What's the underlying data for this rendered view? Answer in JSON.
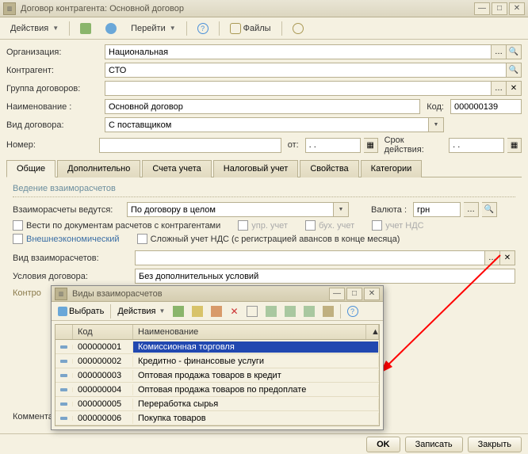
{
  "window": {
    "title": "Договор контрагента: Основной договор"
  },
  "toolbar": {
    "actions": "Действия",
    "goto": "Перейти",
    "files": "Файлы"
  },
  "form": {
    "org_lbl": "Организация:",
    "org_val": "Национальная",
    "contragent_lbl": "Контрагент:",
    "contragent_val": "СТО",
    "group_lbl": "Группа договоров:",
    "group_val": "",
    "name_lbl": "Наименование :",
    "name_val": "Основной договор",
    "code_lbl": "Код:",
    "code_val": "000000139",
    "type_lbl": "Вид договора:",
    "type_val": "С поставщиком",
    "number_lbl": "Номер:",
    "number_val": "",
    "from_lbl": "от:",
    "from_val": ". .",
    "valid_lbl": "Срок действия:",
    "valid_val": ". ."
  },
  "tabs": {
    "t0": "Общие",
    "t1": "Дополнительно",
    "t2": "Счета учета",
    "t3": "Налоговый учет",
    "t4": "Свойства",
    "t5": "Категории"
  },
  "section1": {
    "title": "Ведение взаиморасчетов",
    "calc_lbl": "Взаиморасчеты ведутся:",
    "calc_val": "По договору в целом",
    "currency_lbl": "Валюта :",
    "currency_val": "грн",
    "docs_lbl": "Вести по документам расчетов с контрагентами",
    "upr_lbl": "упр. учет",
    "buh_lbl": "бух. учет",
    "nds_lbl": "учет НДС",
    "foreign_lbl": "Внешнеэкономический",
    "complex_lbl": "Сложный учет НДС (с регистрацией авансов в конце месяца)",
    "calc_type_lbl": "Вид взаиморасчетов:",
    "calc_type_val": "",
    "cond_lbl": "Условия договора:",
    "cond_val": "Без дополнительных условий"
  },
  "section2": {
    "title": "Контро",
    "comment_lbl": "Коммента"
  },
  "popup": {
    "title": "Виды взаиморасчетов",
    "select": "Выбрать",
    "actions": "Действия",
    "col_code": "Код",
    "col_name": "Наименование",
    "rows": [
      {
        "code": "000000001",
        "name": "Комиссионная торговля"
      },
      {
        "code": "000000002",
        "name": "Кредитно - финансовые услуги"
      },
      {
        "code": "000000003",
        "name": "Оптовая продажа товаров в кредит"
      },
      {
        "code": "000000004",
        "name": "Оптовая продажа товаров по предоплате"
      },
      {
        "code": "000000005",
        "name": "Переработка сырья"
      },
      {
        "code": "000000006",
        "name": "Покупка товаров"
      }
    ]
  },
  "footer": {
    "ok": "OK",
    "save": "Записать",
    "close": "Закрыть"
  }
}
